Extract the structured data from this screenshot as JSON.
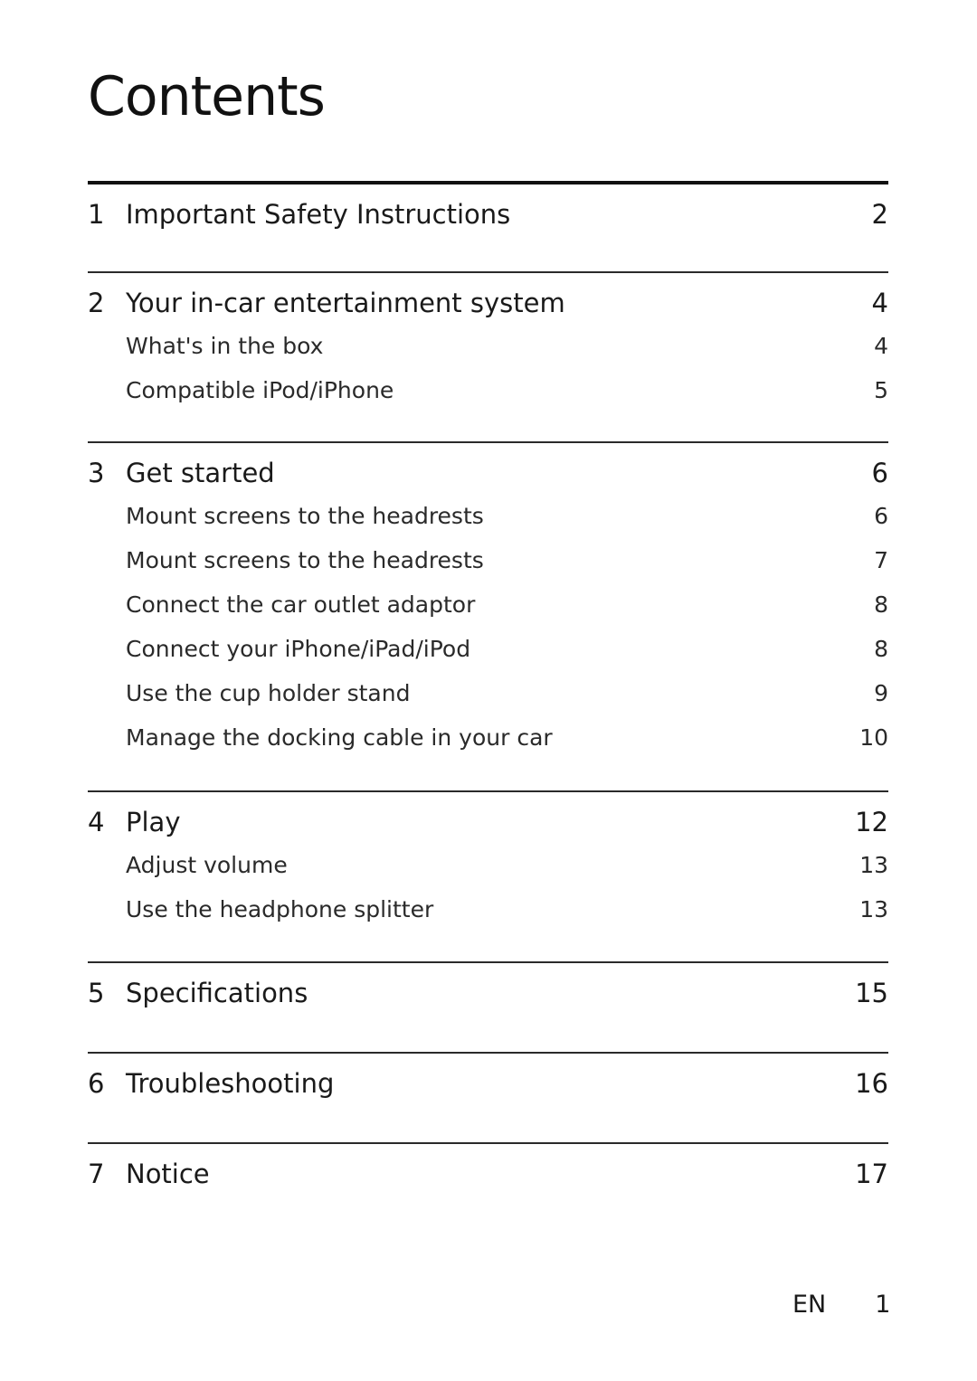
{
  "title": "Contents",
  "sections": [
    {
      "num": "1",
      "label": "Important Safety Instructions",
      "page": "2",
      "items": []
    },
    {
      "num": "2",
      "label": "Your in-car entertainment system",
      "page": "4",
      "items": [
        {
          "label": "What's in the box",
          "page": "4"
        },
        {
          "label": "Compatible iPod/iPhone",
          "page": "5"
        }
      ]
    },
    {
      "num": "3",
      "label": "Get started",
      "page": "6",
      "items": [
        {
          "label": "Mount screens to the headrests",
          "page": "6"
        },
        {
          "label": "Mount screens to the headrests",
          "page": "7"
        },
        {
          "label": "Connect the car outlet adaptor",
          "page": "8"
        },
        {
          "label": "Connect your iPhone/iPad/iPod",
          "page": "8"
        },
        {
          "label": "Use the cup holder stand",
          "page": "9"
        },
        {
          "label": "Manage the docking cable in your car",
          "page": "10"
        }
      ]
    },
    {
      "num": "4",
      "label": "Play",
      "page": "12",
      "items": [
        {
          "label": "Adjust volume",
          "page": "13"
        },
        {
          "label": "Use the headphone splitter",
          "page": "13"
        }
      ]
    },
    {
      "num": "5",
      "label": "Specifications",
      "page": "15",
      "items": []
    },
    {
      "num": "6",
      "label": "Troubleshooting",
      "page": "16",
      "items": []
    },
    {
      "num": "7",
      "label": "Notice",
      "page": "17",
      "items": []
    }
  ],
  "footer": {
    "language": "EN",
    "page_number": "1"
  }
}
